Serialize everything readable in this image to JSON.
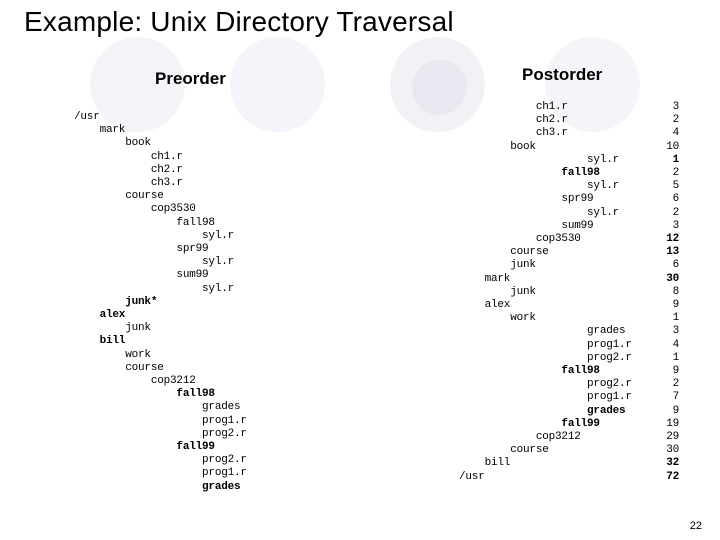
{
  "title": "Example: Unix Directory Traversal",
  "page_number": "22",
  "columns": {
    "preorder": {
      "title": "Preorder",
      "lines": [
        {
          "indent": 0,
          "text": "/usr"
        },
        {
          "indent": 1,
          "text": "mark"
        },
        {
          "indent": 2,
          "text": "book"
        },
        {
          "indent": 3,
          "text": "ch1.r"
        },
        {
          "indent": 3,
          "text": "ch2.r"
        },
        {
          "indent": 3,
          "text": "ch3.r"
        },
        {
          "indent": 2,
          "text": "course"
        },
        {
          "indent": 3,
          "text": "cop3530"
        },
        {
          "indent": 4,
          "text": "fall98"
        },
        {
          "indent": 5,
          "text": "syl.r"
        },
        {
          "indent": 4,
          "text": "spr99"
        },
        {
          "indent": 5,
          "text": "syl.r"
        },
        {
          "indent": 4,
          "text": "sum99"
        },
        {
          "indent": 5,
          "text": "syl.r"
        },
        {
          "indent": 2,
          "text": "junk*",
          "bold": true
        },
        {
          "indent": 1,
          "text": "alex",
          "bold": true
        },
        {
          "indent": 2,
          "text": "junk"
        },
        {
          "indent": 1,
          "text": "bill",
          "bold": true
        },
        {
          "indent": 2,
          "text": "work"
        },
        {
          "indent": 2,
          "text": "course"
        },
        {
          "indent": 3,
          "text": "cop3212"
        },
        {
          "indent": 4,
          "text": "fall98",
          "bold": true
        },
        {
          "indent": 5,
          "text": "grades"
        },
        {
          "indent": 5,
          "text": "prog1.r"
        },
        {
          "indent": 5,
          "text": "prog2.r"
        },
        {
          "indent": 4,
          "text": "fall99",
          "bold": true
        },
        {
          "indent": 5,
          "text": "prog2.r"
        },
        {
          "indent": 5,
          "text": "prog1.r"
        },
        {
          "indent": 5,
          "text": "grades",
          "bold": true
        }
      ]
    },
    "postorder": {
      "title": "Postorder",
      "lines": [
        {
          "indent": 3,
          "text": "ch1.r",
          "value": "3"
        },
        {
          "indent": 3,
          "text": "ch2.r",
          "value": "2"
        },
        {
          "indent": 3,
          "text": "ch3.r",
          "value": "4"
        },
        {
          "indent": 2,
          "text": "book",
          "value": "10"
        },
        {
          "indent": 5,
          "text": "syl.r",
          "value": "1",
          "bold_value": true
        },
        {
          "indent": 4,
          "text": "fall98",
          "value": "2",
          "bold": true
        },
        {
          "indent": 5,
          "text": "syl.r",
          "value": "5"
        },
        {
          "indent": 4,
          "text": "spr99",
          "value": "6"
        },
        {
          "indent": 5,
          "text": "syl.r",
          "value": "2"
        },
        {
          "indent": 4,
          "text": "sum99",
          "value": "3"
        },
        {
          "indent": 3,
          "text": "cop3530",
          "value": "12",
          "bold_value": true
        },
        {
          "indent": 2,
          "text": "course",
          "value": "13",
          "bold_value": true
        },
        {
          "indent": 2,
          "text": "junk",
          "value": "6"
        },
        {
          "indent": 1,
          "text": "mark",
          "value": "30",
          "bold_value": true
        },
        {
          "indent": 2,
          "text": "junk",
          "value": "8"
        },
        {
          "indent": 1,
          "text": "alex",
          "value": "9"
        },
        {
          "indent": 2,
          "text": "work",
          "value": "1"
        },
        {
          "indent": 5,
          "text": "grades",
          "value": "3"
        },
        {
          "indent": 5,
          "text": "prog1.r",
          "value": "4"
        },
        {
          "indent": 5,
          "text": "prog2.r",
          "value": "1"
        },
        {
          "indent": 4,
          "text": "fall98",
          "value": "9",
          "bold": true
        },
        {
          "indent": 5,
          "text": "prog2.r",
          "value": "2"
        },
        {
          "indent": 5,
          "text": "prog1.r",
          "value": "7"
        },
        {
          "indent": 5,
          "text": "grades",
          "value": "9",
          "bold": true
        },
        {
          "indent": 4,
          "text": "fall99",
          "value": "19",
          "bold": true
        },
        {
          "indent": 3,
          "text": "cop3212",
          "value": "29"
        },
        {
          "indent": 2,
          "text": "course",
          "value": "30"
        },
        {
          "indent": 1,
          "text": "bill",
          "value": "32",
          "bold_value": true
        },
        {
          "indent": 0,
          "text": "/usr",
          "value": "72",
          "bold_value": true
        }
      ]
    }
  }
}
